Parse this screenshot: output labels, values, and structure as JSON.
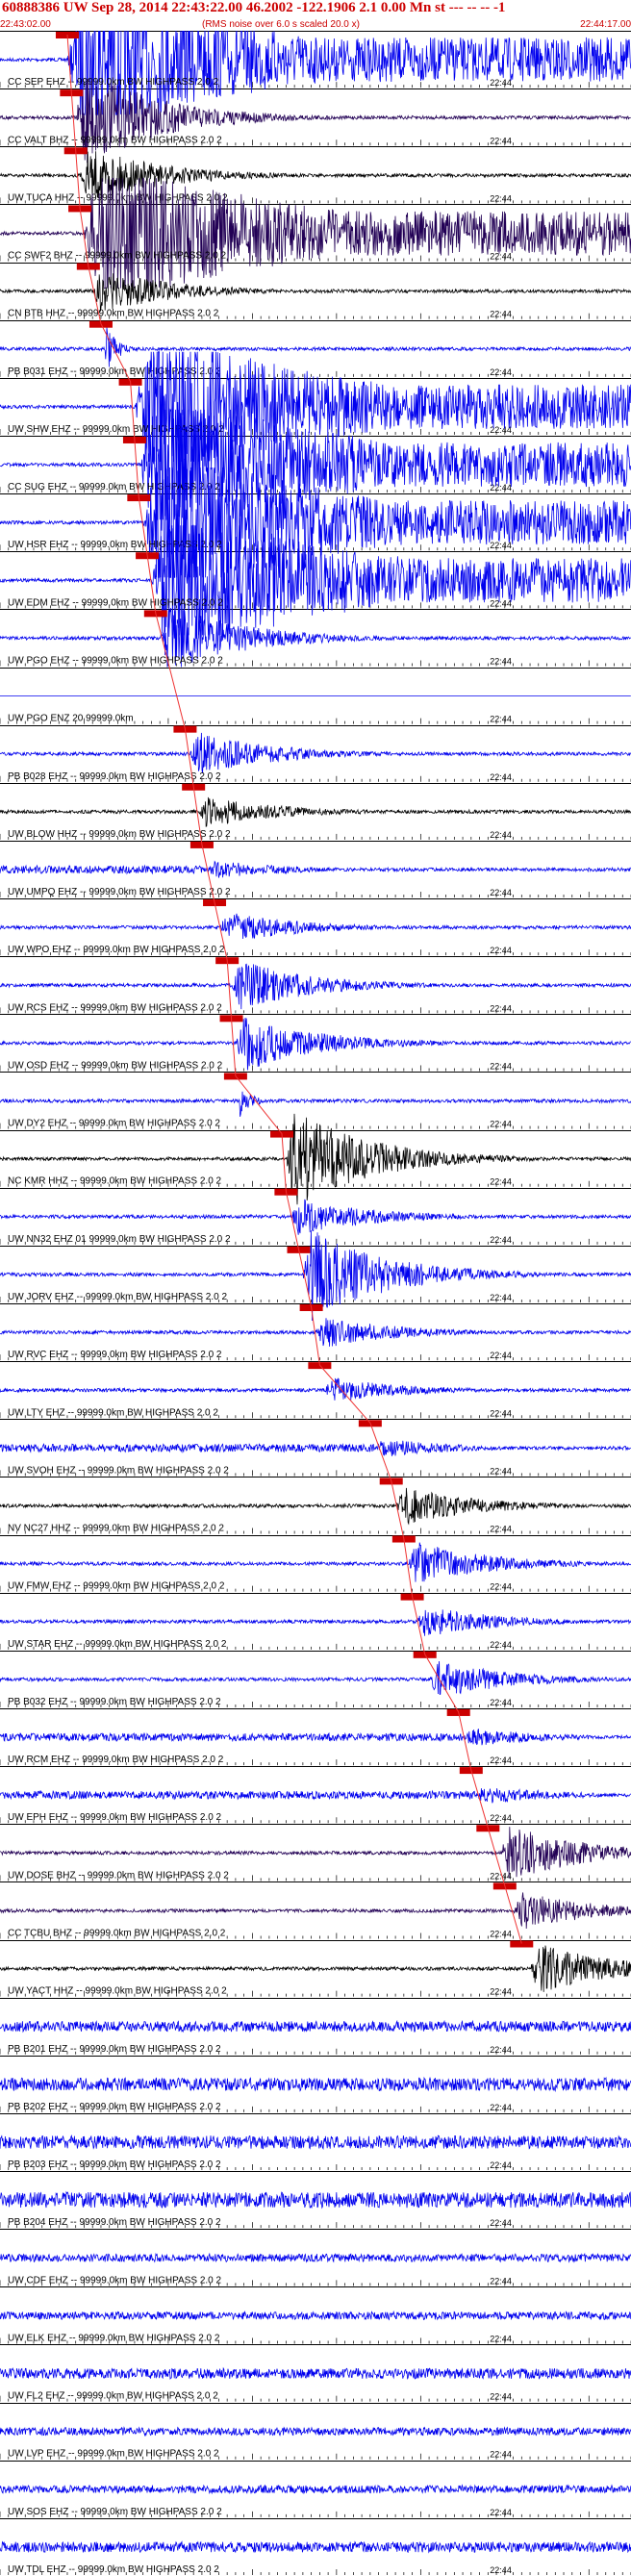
{
  "header": {
    "title": "60888386 UW Sep 28, 2014 22:43:22.00   46.2002 -122.1906  2.1 0.00 Mn st --- -- -- -1",
    "start_time": "22:43:02.00",
    "note": "(RMS noise over 6.0 s scaled 20.0 x)",
    "end_time": "22:44:17.00"
  },
  "chart_data": {
    "type": "line",
    "xlim_seconds": [
      0,
      75
    ],
    "minute_mark_label": "22:44",
    "minute_mark_seconds": 58,
    "tick_interval_seconds": 1,
    "pick_marker_color": "#cc0000",
    "pick_line_color": "#ee3333",
    "traces": [
      {
        "label": "CC SEP EHZ -- 99999.0km BW  HIGHPASS  2.0  2",
        "color": "#0000ee",
        "amp": 1.0,
        "style": "clip",
        "pick": 8,
        "onset": 8
      },
      {
        "label": "CC VALT BHZ -- 99999.0km BW  HIGHPASS  2.0  2",
        "color": "#220055",
        "amp": 0.8,
        "style": "burst",
        "pick": 8.5,
        "onset": 9
      },
      {
        "label": "UW TUCA HHZ -- 99999.0km BW  HIGHPASS  2.0  2",
        "color": "#000000",
        "amp": 0.45,
        "style": "burst",
        "pick": 9,
        "onset": 9.5
      },
      {
        "label": "CC SWF2 BHZ -- 99999.0km BW  HIGHPASS  2.0  2",
        "color": "#220055",
        "amp": 1.0,
        "style": "clip",
        "pick": 9.5,
        "onset": 10
      },
      {
        "label": "CN BTB HHZ -- 99999.0km BW  HIGHPASS  2.0  2",
        "color": "#000000",
        "amp": 0.35,
        "style": "burst",
        "pick": 10.5,
        "onset": 11
      },
      {
        "label": "PB B031 EHZ -- 99999.0km BW  HIGHPASS  2.0  2",
        "color": "#0000ee",
        "amp": 0.5,
        "style": "spike",
        "pick": 12,
        "onset": 12.5
      },
      {
        "label": "UW SHW EHZ -- 99999.0km BW  HIGHPASS  2.0  2",
        "color": "#0000ee",
        "amp": 1.0,
        "style": "clip",
        "pick": 15.5,
        "onset": 16
      },
      {
        "label": "CC SUG EHZ -- 99999.0km BW  HIGHPASS  2.0  2",
        "color": "#0000ee",
        "amp": 1.0,
        "style": "clip",
        "pick": 16,
        "onset": 16.5
      },
      {
        "label": "UW HSR EHZ -- 99999.0km BW  HIGHPASS  2.0  2",
        "color": "#0000ee",
        "amp": 1.0,
        "style": "clip",
        "pick": 16.5,
        "onset": 17
      },
      {
        "label": "UW EDM EHZ -- 99999.0km BW  HIGHPASS  2.0  2",
        "color": "#0000ee",
        "amp": 1.0,
        "style": "clip",
        "pick": 17.5,
        "onset": 18
      },
      {
        "label": "UW PGO EHZ -- 99999.0km BW  HIGHPASS  2.0  2",
        "color": "#0000ee",
        "amp": 0.55,
        "style": "burst",
        "pick": 18.5,
        "onset": 19
      },
      {
        "label": "UW PGO ENZ 20 99999.0km",
        "color": "#0000ee",
        "amp": 0.0,
        "style": "flat",
        "pick": null,
        "onset": null
      },
      {
        "label": "PB B028 EHZ -- 99999.0km BW  HIGHPASS  2.0  2",
        "color": "#0000ee",
        "amp": 0.35,
        "style": "burst",
        "pick": 22,
        "onset": 22.5
      },
      {
        "label": "UW BLOW HHZ -- 99999.0km BW  HIGHPASS  2.0  2",
        "color": "#000000",
        "amp": 0.25,
        "style": "burst",
        "pick": 23,
        "onset": 23.5
      },
      {
        "label": "UW UMPQ EHZ -- 99999.0km BW  HIGHPASS  2.0  2",
        "color": "#0000ee",
        "amp": 0.15,
        "style": "noise",
        "pick": 24,
        "onset": 24.5
      },
      {
        "label": "UW WPO EHZ -- 99999.0km BW  HIGHPASS  2.0  2",
        "color": "#0000ee",
        "amp": 0.25,
        "style": "burst",
        "pick": 25.5,
        "onset": 26
      },
      {
        "label": "UW RCS EHZ -- 99999.0km BW  HIGHPASS  2.0  2",
        "color": "#0000ee",
        "amp": 0.4,
        "style": "burst",
        "pick": 27,
        "onset": 27.5
      },
      {
        "label": "UW OSD EHZ -- 99999.0km BW  HIGHPASS  2.0  2",
        "color": "#0000ee",
        "amp": 0.45,
        "style": "burst",
        "pick": 27.5,
        "onset": 28
      },
      {
        "label": "UW DY2 EHZ -- 99999.0km BW  HIGHPASS  2.0  2",
        "color": "#0000ee",
        "amp": 0.35,
        "style": "spike",
        "pick": 28,
        "onset": 28.5
      },
      {
        "label": "NC KMR HHZ -- 99999.0km BW  HIGHPASS  2.0  2",
        "color": "#000000",
        "amp": 0.8,
        "style": "burst",
        "pick": 33.5,
        "onset": 34
      },
      {
        "label": "UW NN32 EHZ 01 99999.0km BW  HIGHPASS  2.0  2",
        "color": "#0000ee",
        "amp": 0.3,
        "style": "burst",
        "pick": 34,
        "onset": 34.5
      },
      {
        "label": "UW JORV EHZ -- 99999.0km BW  HIGHPASS  2.0  2",
        "color": "#0000ee",
        "amp": 0.75,
        "style": "burst",
        "pick": 35.5,
        "onset": 36
      },
      {
        "label": "UW RVC EHZ -- 99999.0km BW  HIGHPASS  2.0  2",
        "color": "#0000ee",
        "amp": 0.25,
        "style": "burst",
        "pick": 37,
        "onset": 37.5
      },
      {
        "label": "UW LTY EHZ -- 99999.0km BW  HIGHPASS  2.0  2",
        "color": "#0000ee",
        "amp": 0.2,
        "style": "burst",
        "pick": 38,
        "onset": 38.5
      },
      {
        "label": "UW SVOH EHZ -- 99999.0km BW  HIGHPASS  2.0  2",
        "color": "#0000ee",
        "amp": 0.15,
        "style": "noise",
        "pick": 44,
        "onset": 44.5
      },
      {
        "label": "NV NC27 HHZ -- 99999.0km BW  HIGHPASS  2.0  2",
        "color": "#000000",
        "amp": 0.3,
        "style": "burst",
        "pick": 46.5,
        "onset": 47
      },
      {
        "label": "UW FMW EHZ -- 99999.0km BW  HIGHPASS  2.0  2",
        "color": "#0000ee",
        "amp": 0.35,
        "style": "burst",
        "pick": 48,
        "onset": 48.5
      },
      {
        "label": "UW STAR EHZ -- 99999.0km BW  HIGHPASS  2.0  2",
        "color": "#0000ee",
        "amp": 0.25,
        "style": "burst",
        "pick": 49,
        "onset": 49.5
      },
      {
        "label": "PB B032 EHZ -- 99999.0km BW  HIGHPASS  2.0  2",
        "color": "#0000ee",
        "amp": 0.3,
        "style": "burst",
        "pick": 50.5,
        "onset": 51
      },
      {
        "label": "UW RCM EHZ -- 99999.0km BW  HIGHPASS  2.0  2",
        "color": "#0000ee",
        "amp": 0.15,
        "style": "noise",
        "pick": 54.5,
        "onset": 55
      },
      {
        "label": "UW EPH EHZ -- 99999.0km BW  HIGHPASS  2.0  2",
        "color": "#0000ee",
        "amp": 0.15,
        "style": "noise",
        "pick": 56,
        "onset": 56.5
      },
      {
        "label": "UW DOSE BHZ -- 99999.0km BW  HIGHPASS  2.0  2",
        "color": "#220055",
        "amp": 0.45,
        "style": "burst",
        "pick": 58,
        "onset": 59.5
      },
      {
        "label": "CC TCBU BHZ -- 99999.0km BW  HIGHPASS  2.0  2",
        "color": "#220055",
        "amp": 0.3,
        "style": "burst",
        "pick": 60,
        "onset": 61
      },
      {
        "label": "UW YACT HHZ -- 99999.0km BW  HIGHPASS  2.0  2",
        "color": "#000000",
        "amp": 0.4,
        "style": "burst",
        "pick": 62,
        "onset": 63
      },
      {
        "label": "PB B201 EHZ -- 99999.0km BW  HIGHPASS  2.0  2",
        "color": "#0000ee",
        "amp": 0.2,
        "style": "noise",
        "pick": null,
        "onset": null
      },
      {
        "label": "PB B202 EHZ -- 99999.0km BW  HIGHPASS  2.0  2",
        "color": "#0000ee",
        "amp": 0.25,
        "style": "noise",
        "pick": null,
        "onset": null
      },
      {
        "label": "PB B203 EHZ -- 99999.0km BW  HIGHPASS  2.0  2",
        "color": "#0000ee",
        "amp": 0.25,
        "style": "noise",
        "pick": null,
        "onset": null
      },
      {
        "label": "PB B204 EHZ -- 99999.0km BW  HIGHPASS  2.0  2",
        "color": "#0000ee",
        "amp": 0.3,
        "style": "noise",
        "pick": null,
        "onset": null
      },
      {
        "label": "UW CDF EHZ -- 99999.0km BW  HIGHPASS  2.0  2",
        "color": "#0000ee",
        "amp": 0.15,
        "style": "noise",
        "pick": null,
        "onset": null
      },
      {
        "label": "UW ELK EHZ -- 99999.0km BW  HIGHPASS  2.0  2",
        "color": "#0000ee",
        "amp": 0.15,
        "style": "noise",
        "pick": null,
        "onset": null
      },
      {
        "label": "UW FL2 EHZ -- 99999.0km BW  HIGHPASS  2.0  2",
        "color": "#0000ee",
        "amp": 0.2,
        "style": "noise",
        "pick": null,
        "onset": null
      },
      {
        "label": "UW LVP EHZ -- 99999.0km BW  HIGHPASS  2.0  2",
        "color": "#0000ee",
        "amp": 0.15,
        "style": "noise",
        "pick": null,
        "onset": null
      },
      {
        "label": "UW SOS EHZ -- 99999.0km BW  HIGHPASS  2.0  2",
        "color": "#0000ee",
        "amp": 0.15,
        "style": "noise",
        "pick": null,
        "onset": null
      },
      {
        "label": "UW TDL EHZ -- 99999.0km BW  HIGHPASS  2.0  2",
        "color": "#0000ee",
        "amp": 0.2,
        "style": "noise",
        "pick": null,
        "onset": null
      }
    ]
  }
}
